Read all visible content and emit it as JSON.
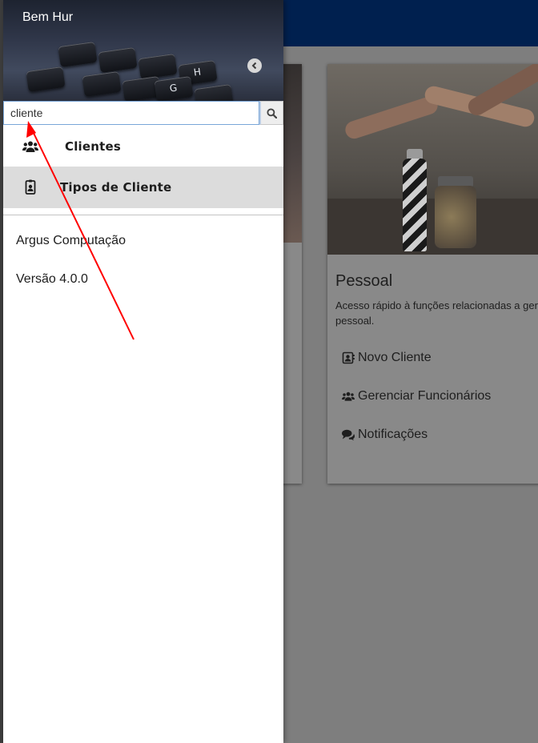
{
  "app": {
    "card_right": {
      "title": "Pessoal",
      "description": "Acesso rápido à funções relacionadas a ger",
      "description_line2": "pessoal.",
      "links": [
        {
          "label": "Novo Cliente",
          "icon": "contact-card-icon"
        },
        {
          "label": "Gerenciar Funcionários",
          "icon": "users-icon"
        },
        {
          "label": "Notificações",
          "icon": "comments-icon"
        }
      ]
    }
  },
  "drawer": {
    "greeting": "Bem Hur",
    "search": {
      "value": "cliente",
      "placeholder": ""
    },
    "menu": [
      {
        "label": "Clientes",
        "icon": "users-icon"
      },
      {
        "label": "Tipos de Cliente",
        "icon": "id-badge-icon"
      }
    ],
    "company": "Argus Computação",
    "version": "Versão 4.0.0",
    "keys": [
      "G",
      "H"
    ]
  },
  "colors": {
    "header_bg": "#00204f",
    "drawer_bg": "#ffffff",
    "selected_item_bg": "#dcdcdc",
    "annotation_arrow": "#ff0000"
  }
}
